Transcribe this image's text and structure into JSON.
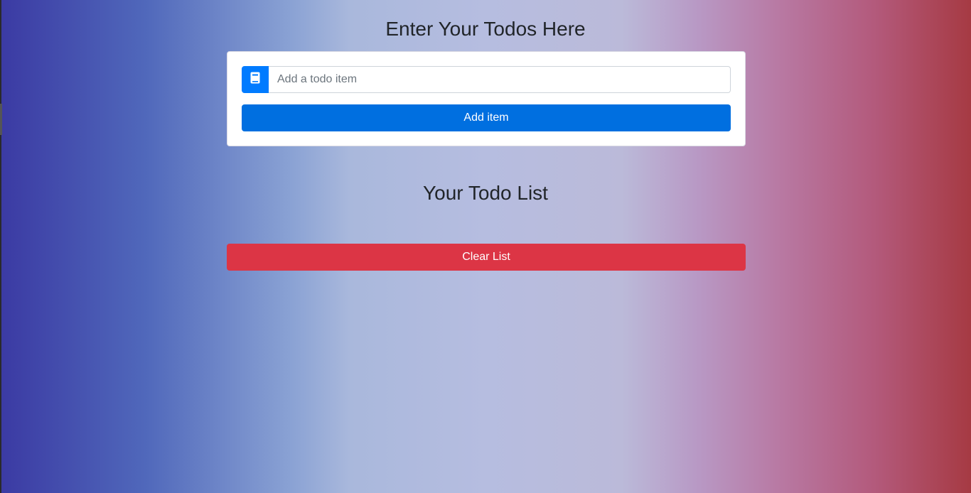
{
  "header": {
    "title": "Enter Your Todos Here"
  },
  "form": {
    "prepend_icon": "book-icon",
    "input": {
      "value": "",
      "placeholder": "Add a todo item"
    },
    "add_button_label": "Add item"
  },
  "list": {
    "title": "Your Todo List",
    "items": [],
    "clear_button_label": "Clear List"
  },
  "colors": {
    "primary": "#007bff",
    "add_button": "#006fe0",
    "danger": "#dc3545",
    "gradient_left": "#3b3aa3",
    "gradient_right": "#a63a43"
  }
}
